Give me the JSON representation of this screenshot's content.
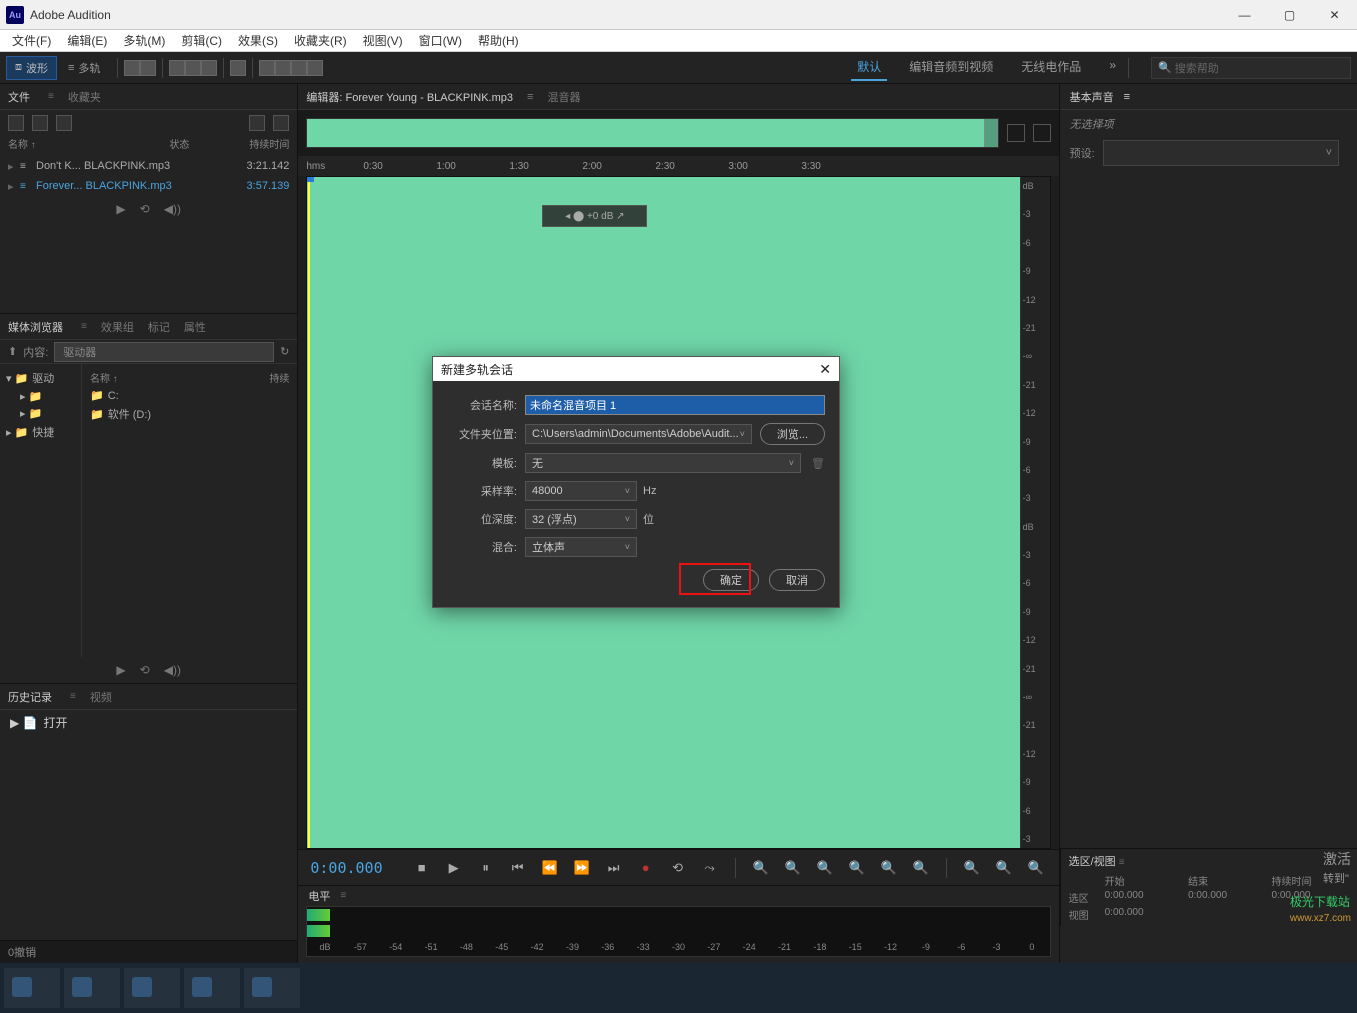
{
  "window": {
    "title": "Adobe Audition",
    "logo": "Au"
  },
  "win_ctrl": {
    "min": "—",
    "max": "▢",
    "close": "✕"
  },
  "menu": [
    "文件(F)",
    "编辑(E)",
    "多轨(M)",
    "剪辑(C)",
    "效果(S)",
    "收藏夹(R)",
    "视图(V)",
    "窗口(W)",
    "帮助(H)"
  ],
  "toolbar": {
    "wave": "波形",
    "multi": "多轨"
  },
  "workspaces": {
    "items": [
      "默认",
      "编辑音频到视频",
      "无线电作品"
    ],
    "more": "»"
  },
  "search": {
    "placeholder": "搜索帮助",
    "icon": "🔍"
  },
  "panels": {
    "files": {
      "tabs": [
        "文件",
        "收藏夹"
      ],
      "header": [
        "名称 ↑",
        "状态",
        "持续时间"
      ],
      "rows": [
        {
          "name": "Don't K... BLACKPINK.mp3",
          "dur": "3:21.142",
          "sel": false
        },
        {
          "name": "Forever... BLACKPINK.mp3",
          "dur": "3:57.139",
          "sel": true
        }
      ]
    },
    "media": {
      "tabs": [
        "媒体浏览器",
        "效果组",
        "标记",
        "属性"
      ],
      "content_label": "内容:",
      "content_value": "驱动器",
      "tree": [
        {
          "label": "驱动",
          "icon": "▸"
        },
        {
          "label": "快捷",
          "icon": "▸",
          "child": false
        }
      ],
      "list_header": [
        "名称 ↑",
        "持续"
      ],
      "list": [
        {
          "name": "C:"
        },
        {
          "name": "软件 (D:)"
        }
      ]
    },
    "history": {
      "tabs": [
        "历史记录",
        "视频"
      ],
      "items": [
        {
          "icon": "▸",
          "label": "打开"
        }
      ]
    },
    "editor": {
      "tab_editor": "编辑器: Forever Young - BLACKPINK.mp3",
      "tab_mixer": "混音器",
      "ruler": [
        "hms",
        "0:30",
        "1:00",
        "1:30",
        "2:00",
        "2:30",
        "3:00",
        "3:30"
      ],
      "db_marks": [
        "dB",
        "-3",
        "-6",
        "-9",
        "-12",
        "-21",
        "-∞",
        "-21",
        "-12",
        "-9",
        "-6",
        "-3",
        "dB",
        "-3",
        "-6",
        "-9",
        "-12",
        "-21",
        "-∞",
        "-21",
        "-12",
        "-9",
        "-6",
        "-3"
      ],
      "hud": "◂ ⬤ +0 dB ↗"
    },
    "transport": {
      "tc": "0:00.000"
    },
    "levels": {
      "tab": "电平",
      "marks": [
        "dB",
        "-57",
        "-54",
        "-51",
        "-48",
        "-45",
        "-42",
        "-39",
        "-36",
        "-33",
        "-30",
        "-27",
        "-24",
        "-21",
        "-18",
        "-15",
        "-12",
        "-9",
        "-6",
        "-3",
        "0"
      ]
    },
    "selection": {
      "tab": "选区/视图",
      "cols": [
        "",
        "开始",
        "结束",
        "持续时间"
      ],
      "rows": [
        [
          "选区",
          "0:00.000",
          "0:00.000",
          "0:00.000"
        ],
        [
          "视图",
          "0:00.000",
          "",
          ""
        ]
      ]
    },
    "basic": {
      "tab": "基本声音",
      "no_sel": "无选择项",
      "preset_label": "预设:"
    }
  },
  "dialog": {
    "title": "新建多轨会话",
    "session_name_label": "会话名称:",
    "session_name": "未命名混音项目 1",
    "folder_label": "文件夹位置:",
    "folder": "C:\\Users\\admin\\Documents\\Adobe\\Audit...",
    "browse": "浏览...",
    "template_label": "模板:",
    "template": "无",
    "samplerate_label": "采样率:",
    "samplerate": "48000",
    "samplerate_unit": "Hz",
    "bitdepth_label": "位深度:",
    "bitdepth": "32 (浮点)",
    "bitdepth_unit": "位",
    "mix_label": "混合:",
    "mix": "立体声",
    "ok": "确定",
    "cancel": "取消"
  },
  "undo": "0撤销",
  "activate": {
    "title": "激活",
    "sub": "转到\""
  },
  "watermark": {
    "brand": "极光下载站",
    "url": "www.xz7.com"
  }
}
